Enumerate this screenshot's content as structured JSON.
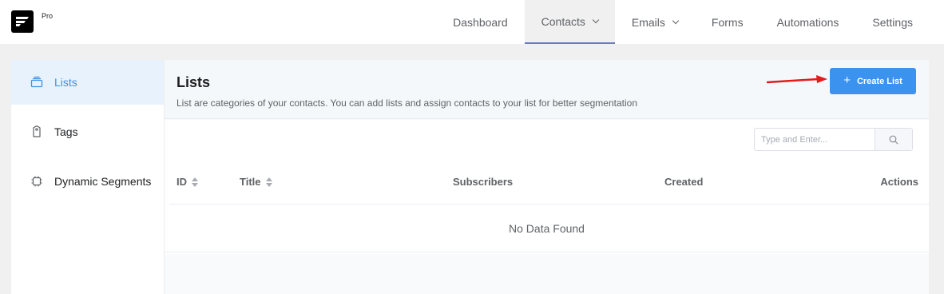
{
  "brand": {
    "badge": "Pro"
  },
  "nav": {
    "items": [
      {
        "label": "Dashboard",
        "dropdown": false
      },
      {
        "label": "Contacts",
        "dropdown": true,
        "active": true
      },
      {
        "label": "Emails",
        "dropdown": true
      },
      {
        "label": "Forms",
        "dropdown": false
      },
      {
        "label": "Automations",
        "dropdown": false
      },
      {
        "label": "Settings",
        "dropdown": false
      }
    ]
  },
  "sidebar": {
    "items": [
      {
        "label": "Lists",
        "icon": "list-icon",
        "active": true
      },
      {
        "label": "Tags",
        "icon": "tag-icon"
      },
      {
        "label": "Dynamic Segments",
        "icon": "chip-icon"
      }
    ]
  },
  "main": {
    "title": "Lists",
    "subtitle": "List are categories of your contacts. You can add lists and assign contacts to your list for better segmentation",
    "create_button": {
      "icon": "+",
      "label": "Create List"
    }
  },
  "search": {
    "placeholder": "Type and Enter..."
  },
  "table": {
    "columns": [
      "ID",
      "Title",
      "Subscribers",
      "Created",
      "Actions"
    ],
    "empty_text": "No Data Found"
  },
  "colors": {
    "accent": "#3b92ef",
    "annotation_arrow": "#e31b1b",
    "nav_active_border": "#6b78c9"
  }
}
